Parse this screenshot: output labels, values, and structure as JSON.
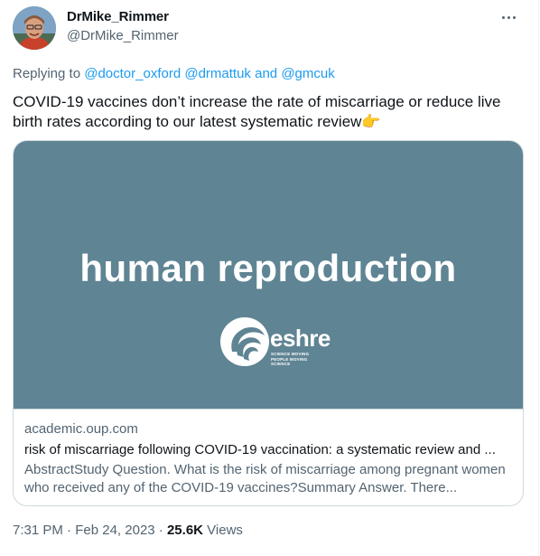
{
  "author": {
    "display_name": "DrMike_Rimmer",
    "handle": "@DrMike_Rimmer",
    "avatar": "avatar-photo"
  },
  "reply": {
    "prefix": "Replying to",
    "mention_1": "@doctor_oxford",
    "mention_2": "@drmattuk",
    "and": "and",
    "mention_3": "@gmcuk"
  },
  "tweet": {
    "text": "COVID-19 vaccines don’t increase the rate of miscarriage or reduce live birth rates according to our latest systematic review👉"
  },
  "card": {
    "image_title": "human reproduction",
    "logo_word": "eshre",
    "logo_tagline": "SCIENCE MOVING PEOPLE MOVING SCIENCE",
    "domain": "academic.oup.com",
    "title": "risk of miscarriage following COVID-19 vaccination: a systematic review and ...",
    "description": "AbstractStudy Question. What is the risk of miscarriage among pregnant women who received any of the COVID-19 vaccines?Summary Answer. There..."
  },
  "meta": {
    "time": "7:31 PM",
    "sep1": " · ",
    "date": "Feb 24, 2023",
    "sep2": " · ",
    "views_count": "25.6K",
    "views_label": " Views"
  },
  "colors": {
    "link": "#1d9bf0",
    "muted": "#536471",
    "card_bg": "#5f8494"
  }
}
